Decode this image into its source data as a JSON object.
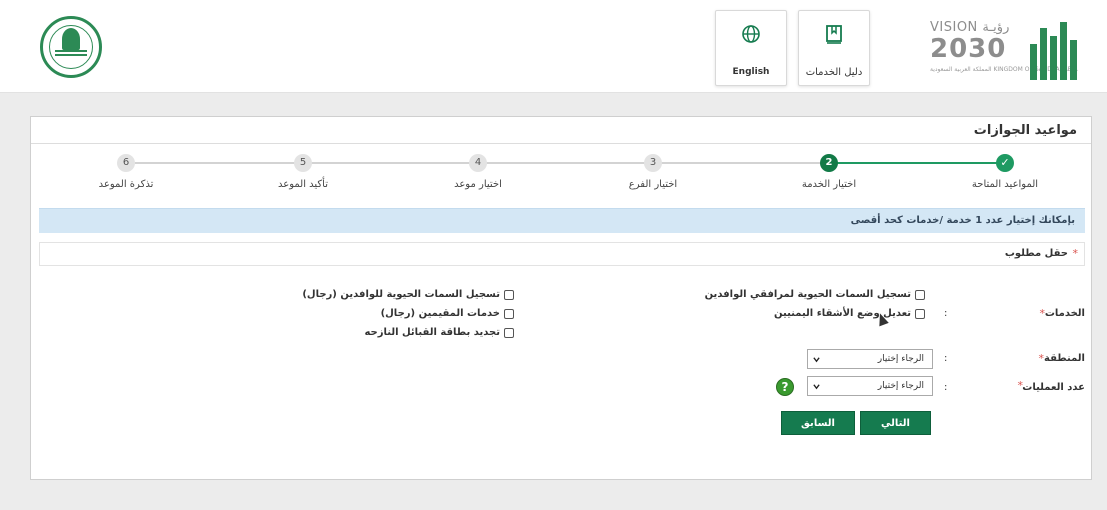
{
  "header": {
    "guide_label": "دليل الخدمات",
    "english_label": "English",
    "vision": {
      "title": "VISION رؤيـة",
      "year": "2030",
      "subtitle": "المملكة العربية السعودية KINGDOM OF SAUDI ARABIA"
    },
    "icons": {
      "emblem": "saudi-emblem-icon",
      "guide": "book-icon",
      "language": "globe-icon",
      "brand": "absher-logo-icon"
    },
    "colors": {
      "brand_green": "#1e9a62",
      "dark_green": "#157b4f"
    }
  },
  "page": {
    "title": "مواعيد الجوازات"
  },
  "steps": [
    {
      "label": "المواعيد المتاحة",
      "number": "✓",
      "state": "done"
    },
    {
      "label": "اختيار الخدمة",
      "number": "2",
      "state": "active"
    },
    {
      "label": "اختيار الفرع",
      "number": "3",
      "state": "pending"
    },
    {
      "label": "اختيار موعد",
      "number": "4",
      "state": "pending"
    },
    {
      "label": "تأكيد الموعد",
      "number": "5",
      "state": "pending"
    },
    {
      "label": "تذكرة الموعد",
      "number": "6",
      "state": "pending"
    }
  ],
  "info": {
    "text": "بإمكانك إختيار عدد 1 خدمة /خدمات كحد أقصى"
  },
  "required": {
    "star": "*",
    "text": "حقل مطلوب"
  },
  "form": {
    "services_label": "الخدمات",
    "region_label": "المنطقة",
    "ops_label": "عدد العمليات",
    "star": "*",
    "colon": ":",
    "services": [
      "تسجيل السمات الحيوية لمرافقي الوافدين",
      "تعديل وضع الأشقاء اليمنيين",
      "تسجيل السمات الحيوية للوافدين (رجال)",
      "خدمات المقيمين (رجال)",
      "تجديد بطاقة القبائل النازحه"
    ],
    "region_value": "الرجاء إختيار",
    "ops_value": "الرجاء إختيار",
    "help_symbol": "?"
  },
  "buttons": {
    "next": "التالي",
    "previous": "السابق"
  }
}
